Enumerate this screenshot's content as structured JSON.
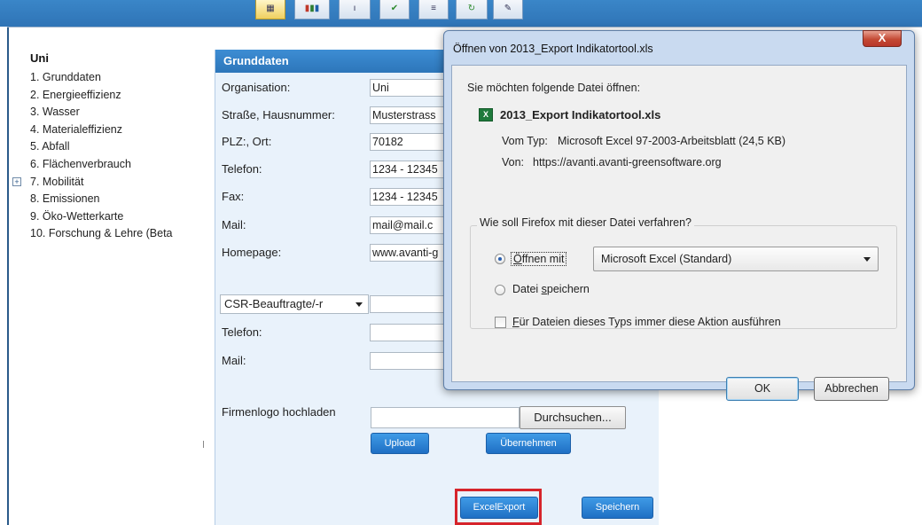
{
  "toolbar": {
    "icons": [
      "table-icon",
      "bar-chart-icon",
      "pin-icon",
      "check-icon",
      "list-icon",
      "arrow-icon",
      "edit-icon"
    ]
  },
  "nav": {
    "header": "Uni",
    "items": [
      "1. Grunddaten",
      "2. Energieeffizienz",
      "3. Wasser",
      "4. Materialeffizienz",
      "5. Abfall",
      "6. Flächenverbrauch",
      "7. Mobilität",
      "8. Emissionen",
      "9. Öko-Wetterkarte",
      "10. Forschung & Lehre (Beta"
    ],
    "expand_symbol": "+"
  },
  "form": {
    "title": "Grunddaten",
    "fields": [
      {
        "label": "Organisation:",
        "value": "Uni"
      },
      {
        "label": "Straße, Hausnummer:",
        "value": "Musterstrass"
      },
      {
        "label": "PLZ:, Ort:",
        "value": "70182"
      },
      {
        "label": "Telefon:",
        "value": "1234 - 12345"
      },
      {
        "label": "Fax:",
        "value": "1234 - 12345"
      },
      {
        "label": "Mail:",
        "value": "mail@mail.c"
      },
      {
        "label": "Homepage:",
        "value": "www.avanti-g"
      }
    ],
    "contact_select": "CSR-Beauftragte/-r",
    "contact_phone_label": "Telefon:",
    "contact_mail_label": "Mail:",
    "logo_label": "Firmenlogo hochladen",
    "browse_label": "Durchsuchen...",
    "upload_label": "Upload",
    "apply_label": "Übernehmen",
    "excel_export_label": "ExcelExport",
    "save_label": "Speichern"
  },
  "dialog": {
    "title": "Öffnen von 2013_Export Indikatortool.xls",
    "close_symbol": "X",
    "intro": "Sie möchten folgende Datei öffnen:",
    "file_name": "2013_Export Indikatortool.xls",
    "type_label": "Vom Typ:",
    "type_value": "Microsoft Excel 97-2003-Arbeitsblatt (24,5 KB)",
    "from_label": "Von:",
    "from_value": "https://avanti.avanti-greensoftware.org",
    "question": "Wie soll Firefox mit dieser Datei verfahren?",
    "open_with_mnemonic": "Ö",
    "open_with_rest": "ffnen mit",
    "open_with_app": "Microsoft Excel (Standard)",
    "save_file_pre": "Datei ",
    "save_file_mnemonic": "s",
    "save_file_post": "peichern",
    "always_mnemonic": "F",
    "always_rest": "ür Dateien dieses Typs immer diese Aktion ausführen",
    "ok_label": "OK",
    "cancel_label": "Abbrechen"
  }
}
